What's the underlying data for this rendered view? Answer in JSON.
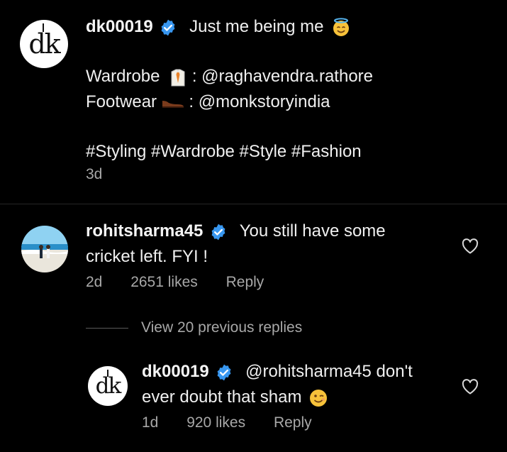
{
  "post": {
    "username": "dk00019",
    "caption_first": "Just me being me",
    "wardrobe_label": "Wardrobe",
    "wardrobe_handle": ": @raghavendra.rathore",
    "footwear_label": "Footwear",
    "footwear_handle": ": @monkstoryindia",
    "hashtags": "#Styling #Wardrobe #Style #Fashion",
    "time": "3d",
    "avatar_text": "dk"
  },
  "comment": {
    "username": "rohitsharma45",
    "text_line1": "You still have some",
    "text_line2": "cricket left. FYI !",
    "time": "2d",
    "likes": "2651 likes",
    "reply_label": "Reply"
  },
  "view_replies": "View 20 previous replies",
  "reply": {
    "username": "dk00019",
    "text_line1": "@rohitsharma45 don't",
    "text_line2": "ever doubt that sham",
    "time": "1d",
    "likes": "920 likes",
    "reply_label": "Reply",
    "avatar_text": "dk"
  },
  "colors": {
    "background": "#000000",
    "verified": "#3897f0",
    "secondary_text": "#a8a8a8"
  },
  "icons": [
    "verified-badge-icon",
    "halo-smile-emoji",
    "shirt-tie-emoji",
    "shoe-emoji",
    "wink-emoji",
    "heart-icon"
  ]
}
